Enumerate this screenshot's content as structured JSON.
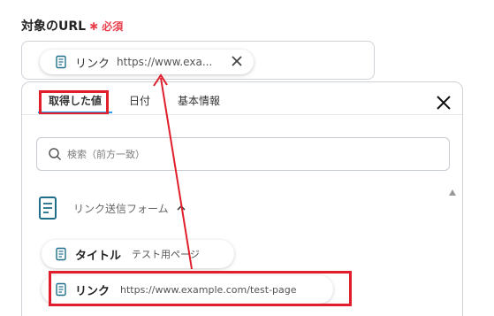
{
  "field": {
    "label": "対象のURL",
    "required_mark": "✱ 必須"
  },
  "chip": {
    "title": "リンク",
    "value": "https://www.exa..."
  },
  "panel": {
    "tabs": [
      {
        "label": "取得した値",
        "active": true
      },
      {
        "label": "日付",
        "active": false
      },
      {
        "label": "基本情報",
        "active": false
      }
    ],
    "search_placeholder": "検索（前方一致）",
    "section_title": "リンク送信フォーム",
    "rows": [
      {
        "title": "タイトル",
        "value": "テスト用ページ"
      },
      {
        "title": "リンク",
        "value": "https://www.example.com/test-page"
      }
    ]
  },
  "colors": {
    "highlight": "#e01e2c",
    "required": "#e8424f",
    "tab_underline": "#2c9cf0"
  },
  "icons": [
    "document-icon",
    "close-icon",
    "search-icon",
    "chevron-up-icon",
    "scroll-up-icon"
  ]
}
